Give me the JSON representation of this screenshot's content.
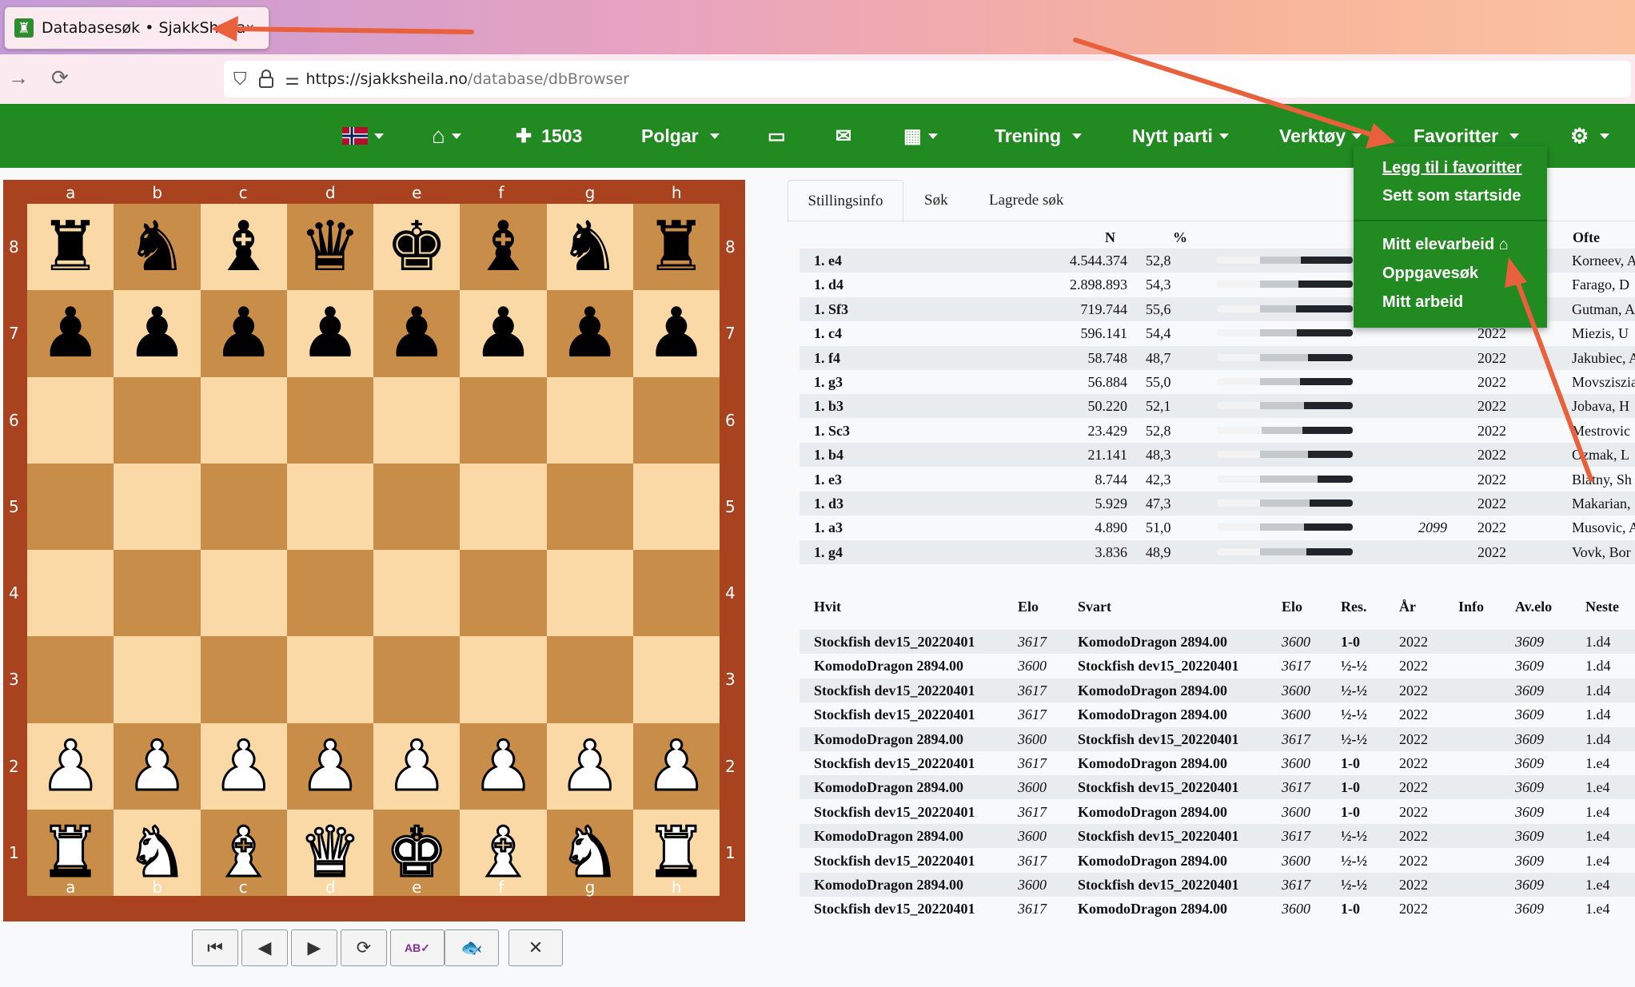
{
  "browser": {
    "tab_title": "Databasesøk • SjakkSheila",
    "tab_close": "×",
    "url_host": "https://sjakksheila.no",
    "url_path": "/database/dbBrowser"
  },
  "nav": {
    "rating": "1503",
    "polgar": "Polgar",
    "trening": "Trening",
    "nytt_parti": "Nytt parti",
    "verktoy": "Verktøy",
    "favoritter": "Favoritter"
  },
  "fav_menu": {
    "add": "Legg til i favoritter",
    "startpage": "Sett som startside",
    "elevarbeid": "Mitt elevarbeid",
    "oppgavesok": "Oppgavesøk",
    "arbeid": "Mitt arbeid"
  },
  "board": {
    "files": [
      "a",
      "b",
      "c",
      "d",
      "e",
      "f",
      "g",
      "h"
    ],
    "ranks": [
      "8",
      "7",
      "6",
      "5",
      "4",
      "3",
      "2",
      "1"
    ],
    "position": [
      [
        "r",
        "n",
        "b",
        "q",
        "k",
        "b",
        "n",
        "r"
      ],
      [
        "p",
        "p",
        "p",
        "p",
        "p",
        "p",
        "p",
        "p"
      ],
      [
        "",
        "",
        "",
        "",
        "",
        "",
        "",
        ""
      ],
      [
        "",
        "",
        "",
        "",
        "",
        "",
        "",
        ""
      ],
      [
        "",
        "",
        "",
        "",
        "",
        "",
        "",
        ""
      ],
      [
        "",
        "",
        "",
        "",
        "",
        "",
        "",
        ""
      ],
      [
        "P",
        "P",
        "P",
        "P",
        "P",
        "P",
        "P",
        "P"
      ],
      [
        "R",
        "N",
        "B",
        "Q",
        "K",
        "B",
        "N",
        "R"
      ]
    ]
  },
  "board_buttons": [
    {
      "name": "first-move-button",
      "glyph": "⏮"
    },
    {
      "name": "prev-move-button",
      "glyph": "◀"
    },
    {
      "name": "next-move-button",
      "glyph": "▶"
    },
    {
      "name": "flip-board-button",
      "glyph": "⟳"
    },
    {
      "name": "notation-button",
      "glyph": "AB✓"
    },
    {
      "name": "engine-button",
      "glyph": "🐟"
    },
    {
      "name": "tools-button",
      "glyph": "✕"
    }
  ],
  "tabs": [
    "Stillingsinfo",
    "Søk",
    "Lagrede søk"
  ],
  "moves_header": {
    "n": "N",
    "pct": "%",
    "ofte": "Ofte"
  },
  "moves": [
    {
      "move": "1. e4",
      "n": "4.544.374",
      "pct": "52,8",
      "elo": "",
      "year": "",
      "ofte": "Korneev, A",
      "bar": [
        0.38,
        0.3
      ]
    },
    {
      "move": "1. d4",
      "n": "2.898.893",
      "pct": "54,3",
      "elo": "",
      "year": "",
      "ofte": "Farago, D",
      "bar": [
        0.4,
        0.28
      ]
    },
    {
      "move": "1. Sf3",
      "n": "719.744",
      "pct": "55,6",
      "elo": "",
      "year": "",
      "ofte": "Gutman, A",
      "bar": [
        0.42,
        0.26
      ]
    },
    {
      "move": "1. c4",
      "n": "596.141",
      "pct": "54,4",
      "elo": "",
      "year": "2022",
      "ofte": "Miezis, U",
      "bar": [
        0.41,
        0.27
      ]
    },
    {
      "move": "1. f4",
      "n": "58.748",
      "pct": "48,7",
      "elo": "",
      "year": "2022",
      "ofte": "Jakubiec, A",
      "bar": [
        0.33,
        0.35
      ]
    },
    {
      "move": "1. g3",
      "n": "56.884",
      "pct": "55,0",
      "elo": "",
      "year": "2022",
      "ofte": "Movsziszian",
      "bar": [
        0.39,
        0.29
      ]
    },
    {
      "move": "1. b3",
      "n": "50.220",
      "pct": "52,1",
      "elo": "",
      "year": "2022",
      "ofte": "Jobava, H",
      "bar": [
        0.36,
        0.32
      ]
    },
    {
      "move": "1. Sc3",
      "n": "23.429",
      "pct": "52,8",
      "elo": "",
      "year": "2022",
      "ofte": "Mestrovic",
      "bar": [
        0.37,
        0.3
      ]
    },
    {
      "move": "1. b4",
      "n": "21.141",
      "pct": "48,3",
      "elo": "",
      "year": "2022",
      "ofte": "Ozmak, L",
      "bar": [
        0.33,
        0.35
      ]
    },
    {
      "move": "1. e3",
      "n": "8.744",
      "pct": "42,3",
      "elo": "",
      "year": "2022",
      "ofte": "Blatny, Sh",
      "bar": [
        0.26,
        0.42
      ]
    },
    {
      "move": "1. d3",
      "n": "5.929",
      "pct": "47,3",
      "elo": "",
      "year": "2022",
      "ofte": "Makarian,",
      "bar": [
        0.32,
        0.36
      ]
    },
    {
      "move": "1. a3",
      "n": "4.890",
      "pct": "51,0",
      "elo": "2099",
      "year": "2022",
      "ofte": "Musovic, A",
      "bar": [
        0.36,
        0.32
      ]
    },
    {
      "move": "1. g4",
      "n": "3.836",
      "pct": "48,9",
      "elo": "",
      "year": "2022",
      "ofte": "Vovk, Bor",
      "bar": [
        0.34,
        0.34
      ]
    }
  ],
  "games_header": {
    "hvit": "Hvit",
    "elo1": "Elo",
    "svart": "Svart",
    "elo2": "Elo",
    "res": "Res.",
    "ar": "År",
    "info": "Info",
    "avelo": "Av.elo",
    "neste": "Neste"
  },
  "games": [
    {
      "hvit": "Stockfish dev15_20220401",
      "elo1": "3617",
      "svart": "KomodoDragon 2894.00",
      "elo2": "3600",
      "res": "1-0",
      "ar": "2022",
      "info": "",
      "avelo": "3609",
      "neste": "1.d4"
    },
    {
      "hvit": "KomodoDragon 2894.00",
      "elo1": "3600",
      "svart": "Stockfish dev15_20220401",
      "elo2": "3617",
      "res": "½-½",
      "ar": "2022",
      "info": "",
      "avelo": "3609",
      "neste": "1.d4"
    },
    {
      "hvit": "Stockfish dev15_20220401",
      "elo1": "3617",
      "svart": "KomodoDragon 2894.00",
      "elo2": "3600",
      "res": "½-½",
      "ar": "2022",
      "info": "",
      "avelo": "3609",
      "neste": "1.d4"
    },
    {
      "hvit": "Stockfish dev15_20220401",
      "elo1": "3617",
      "svart": "KomodoDragon 2894.00",
      "elo2": "3600",
      "res": "½-½",
      "ar": "2022",
      "info": "",
      "avelo": "3609",
      "neste": "1.d4"
    },
    {
      "hvit": "KomodoDragon 2894.00",
      "elo1": "3600",
      "svart": "Stockfish dev15_20220401",
      "elo2": "3617",
      "res": "½-½",
      "ar": "2022",
      "info": "",
      "avelo": "3609",
      "neste": "1.d4"
    },
    {
      "hvit": "Stockfish dev15_20220401",
      "elo1": "3617",
      "svart": "KomodoDragon 2894.00",
      "elo2": "3600",
      "res": "1-0",
      "ar": "2022",
      "info": "",
      "avelo": "3609",
      "neste": "1.e4"
    },
    {
      "hvit": "KomodoDragon 2894.00",
      "elo1": "3600",
      "svart": "Stockfish dev15_20220401",
      "elo2": "3617",
      "res": "1-0",
      "ar": "2022",
      "info": "",
      "avelo": "3609",
      "neste": "1.e4"
    },
    {
      "hvit": "Stockfish dev15_20220401",
      "elo1": "3617",
      "svart": "KomodoDragon 2894.00",
      "elo2": "3600",
      "res": "1-0",
      "ar": "2022",
      "info": "",
      "avelo": "3609",
      "neste": "1.e4"
    },
    {
      "hvit": "KomodoDragon 2894.00",
      "elo1": "3600",
      "svart": "Stockfish dev15_20220401",
      "elo2": "3617",
      "res": "½-½",
      "ar": "2022",
      "info": "",
      "avelo": "3609",
      "neste": "1.e4"
    },
    {
      "hvit": "Stockfish dev15_20220401",
      "elo1": "3617",
      "svart": "KomodoDragon 2894.00",
      "elo2": "3600",
      "res": "½-½",
      "ar": "2022",
      "info": "",
      "avelo": "3609",
      "neste": "1.e4"
    },
    {
      "hvit": "KomodoDragon 2894.00",
      "elo1": "3600",
      "svart": "Stockfish dev15_20220401",
      "elo2": "3617",
      "res": "½-½",
      "ar": "2022",
      "info": "",
      "avelo": "3609",
      "neste": "1.e4"
    },
    {
      "hvit": "Stockfish dev15_20220401",
      "elo1": "3617",
      "svart": "KomodoDragon 2894.00",
      "elo2": "3600",
      "res": "1-0",
      "ar": "2022",
      "info": "",
      "avelo": "3609",
      "neste": "1.e4"
    }
  ],
  "colors": {
    "nav_green": "#218a21",
    "board_border": "#a8421f",
    "light_square": "#fad9a6",
    "dark_square": "#c88d48",
    "annotation_arrow": "#e8603c"
  }
}
